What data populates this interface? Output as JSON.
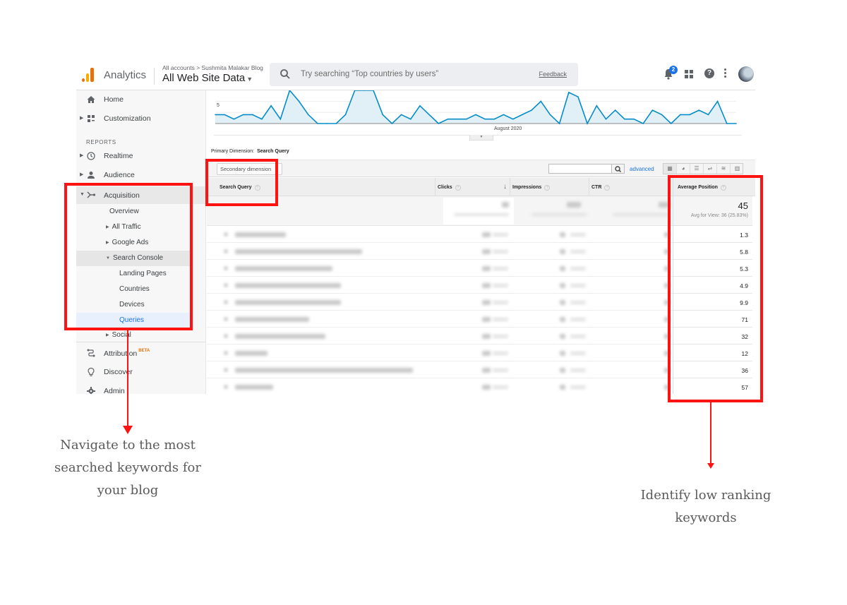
{
  "header": {
    "app_name": "Analytics",
    "breadcrumb": "All accounts > Sushmita Malakar Blog",
    "property": "All Web Site Data",
    "search_placeholder": "Try searching “Top countries by users”",
    "feedback": "Feedback",
    "notification_count": "2",
    "help_glyph": "?"
  },
  "sidebar": {
    "section_reports": "REPORTS",
    "items": [
      {
        "label": "Home",
        "icon": "home-icon"
      },
      {
        "label": "Customization",
        "icon": "dashboard-icon"
      },
      {
        "label": "Realtime",
        "icon": "clock-icon"
      },
      {
        "label": "Audience",
        "icon": "person-icon"
      },
      {
        "label": "Acquisition",
        "icon": "acquisition-icon"
      },
      {
        "label": "Attribution",
        "icon": "attribution-icon",
        "badge": "BETA"
      },
      {
        "label": "Discover",
        "icon": "lightbulb-icon"
      },
      {
        "label": "Admin",
        "icon": "gear-icon"
      }
    ],
    "acquisition_children": [
      {
        "label": "Overview"
      },
      {
        "label": "All Traffic"
      },
      {
        "label": "Google Ads"
      },
      {
        "label": "Search Console"
      },
      {
        "label": "Landing Pages"
      },
      {
        "label": "Countries"
      },
      {
        "label": "Devices"
      },
      {
        "label": "Queries"
      },
      {
        "label": "Social"
      }
    ]
  },
  "chart_data": {
    "type": "area",
    "title": "",
    "xlabel": "August 2020",
    "ylabel": "",
    "y_tick_labels": [
      "5"
    ],
    "ylim": [
      0,
      8
    ],
    "grid": true,
    "series": [
      {
        "name": "Clicks",
        "color": "#058dc7",
        "values": [
          2,
          2,
          1,
          2,
          2,
          1,
          4,
          1,
          8,
          5,
          2,
          0,
          0,
          0,
          2,
          8,
          8,
          8,
          2,
          0,
          2,
          1,
          4,
          2,
          0,
          1,
          1,
          1,
          2,
          1,
          1,
          2,
          1,
          2,
          3,
          5,
          2,
          0,
          7,
          6,
          0,
          4,
          1,
          3,
          1,
          1,
          0,
          3,
          2,
          0,
          2,
          2,
          3,
          2,
          5,
          0,
          0
        ]
      }
    ]
  },
  "report": {
    "primary_dimension_label": "Primary Dimension:",
    "primary_dimension_value": "Search Query",
    "secondary_dimension_button": "Secondary dimension",
    "advanced_link": "advanced",
    "view_icons": [
      "table-view-icon",
      "pie-view-icon",
      "performance-view-icon",
      "comparison-view-icon",
      "term-cloud-view-icon",
      "pivot-view-icon"
    ],
    "columns": [
      "Search Query",
      "Clicks",
      "Impressions",
      "CTR",
      "Average Position"
    ],
    "help_glyph": "?",
    "average_position": {
      "total": "45",
      "avg_for_view": "Avg for View: 36 (25.83%)",
      "values": [
        "1.3",
        "5.8",
        "5.3",
        "4.9",
        "9.9",
        "71",
        "32",
        "12",
        "36",
        "57"
      ]
    }
  },
  "annotations": {
    "left_caption": "Navigate to the most searched keywords for your blog",
    "right_caption": "Identify low ranking keywords",
    "highlight_color": "#ff1212"
  }
}
